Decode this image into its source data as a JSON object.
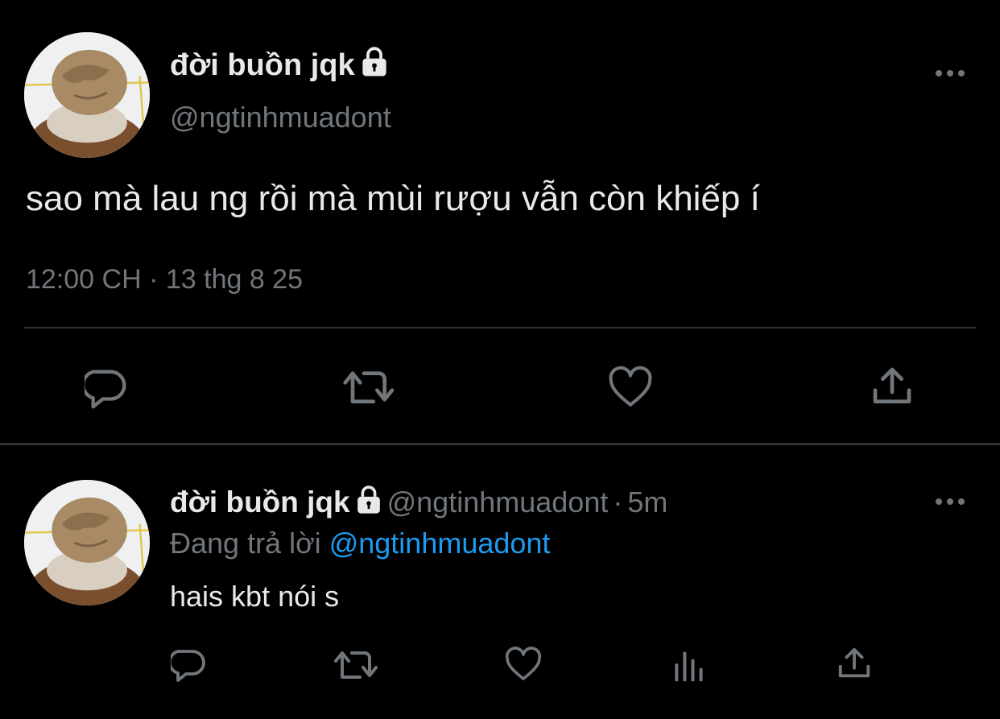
{
  "main_tweet": {
    "display_name": "đời buồn jqk",
    "handle": "@ngtinhmuadont",
    "text": "sao mà lau ng rồi mà mùi rượu vẫn còn khiếp í",
    "timestamp": "12:00 CH · 13 thg 8 25",
    "icons": [
      "lock-icon",
      "more-icon",
      "reply-icon",
      "retweet-icon",
      "like-icon",
      "share-icon"
    ]
  },
  "reply_tweet": {
    "display_name": "đời buồn jqk",
    "handle": "@ngtinhmuadont",
    "separator": "·",
    "age": "5m",
    "replying_prefix": "Đang trả lời",
    "replying_to": "@ngtinhmuadont",
    "text": "hais kbt nói s",
    "icons": [
      "lock-icon",
      "more-icon",
      "reply-icon",
      "retweet-icon",
      "like-icon",
      "analytics-icon",
      "share-icon"
    ]
  },
  "colors": {
    "background": "#000000",
    "text": "#e7e9ea",
    "secondary": "#71767b",
    "link": "#1d9bf0",
    "divider": "#2f3336"
  }
}
